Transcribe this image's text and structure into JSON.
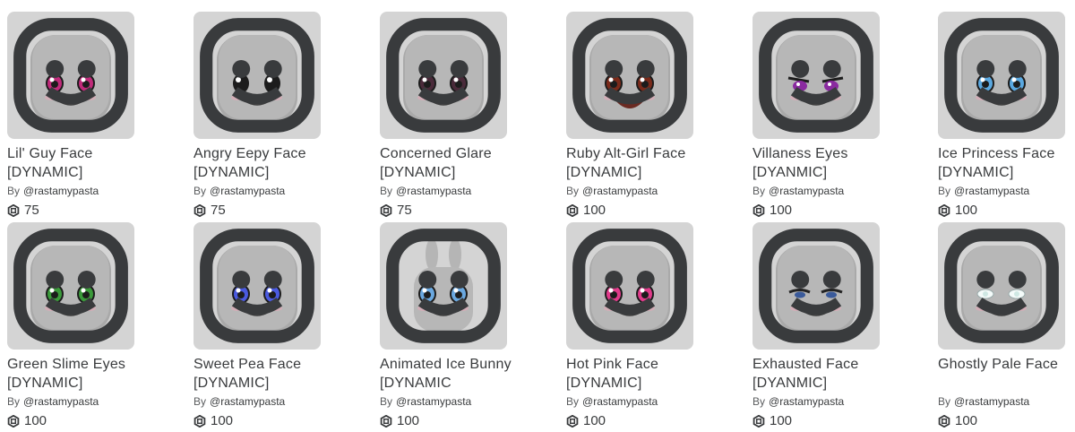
{
  "by_label": "By",
  "items": [
    {
      "name": "Lil' Guy Face [DYNAMIC]",
      "creator": "@rastamypasta",
      "price": "75",
      "eye": "#c02a7a",
      "style": "round"
    },
    {
      "name": "Angry Eepy Face [DYNAMIC]",
      "creator": "@rastamypasta",
      "price": "75",
      "eye": "#2b2b2b",
      "style": "dark"
    },
    {
      "name": "Concerned Glare [DYNAMIC]",
      "creator": "@rastamypasta",
      "price": "75",
      "eye": "#4a2a3a",
      "style": "lash"
    },
    {
      "name": "Ruby Alt-Girl Face [DYNAMIC]",
      "creator": "@rastamypasta",
      "price": "100",
      "eye": "#7a2a1a",
      "style": "open"
    },
    {
      "name": "Villaness Eyes [DYANMIC]",
      "creator": "@rastamypasta",
      "price": "100",
      "eye": "#8a2aa0",
      "style": "sly"
    },
    {
      "name": "Ice Princess Face [DYNAMIC]",
      "creator": "@rastamypasta",
      "price": "100",
      "eye": "#5aa8e0",
      "style": "round"
    },
    {
      "name": "Green Slime Eyes [DYNAMIC]",
      "creator": "@rastamypasta",
      "price": "100",
      "eye": "#3a9a3a",
      "style": "round"
    },
    {
      "name": "Sweet Pea Face [DYNAMIC]",
      "creator": "@rastamypasta",
      "price": "100",
      "eye": "#4a5ae0",
      "style": "round"
    },
    {
      "name": "Animated Ice Bunny [DYNAMIC",
      "creator": "@rastamypasta",
      "price": "100",
      "eye": "#6aa8e0",
      "style": "bunny"
    },
    {
      "name": "Hot Pink Face [DYNAMIC]",
      "creator": "@rastamypasta",
      "price": "100",
      "eye": "#e03a8a",
      "style": "round"
    },
    {
      "name": "Exhausted Face [DYANMIC]",
      "creator": "@rastamypasta",
      "price": "100",
      "eye": "#3a5a9a",
      "style": "tired"
    },
    {
      "name": "Ghostly Pale Face",
      "creator": "@rastamypasta",
      "price": "100",
      "eye": "#cfe8e4",
      "style": "pale"
    }
  ]
}
